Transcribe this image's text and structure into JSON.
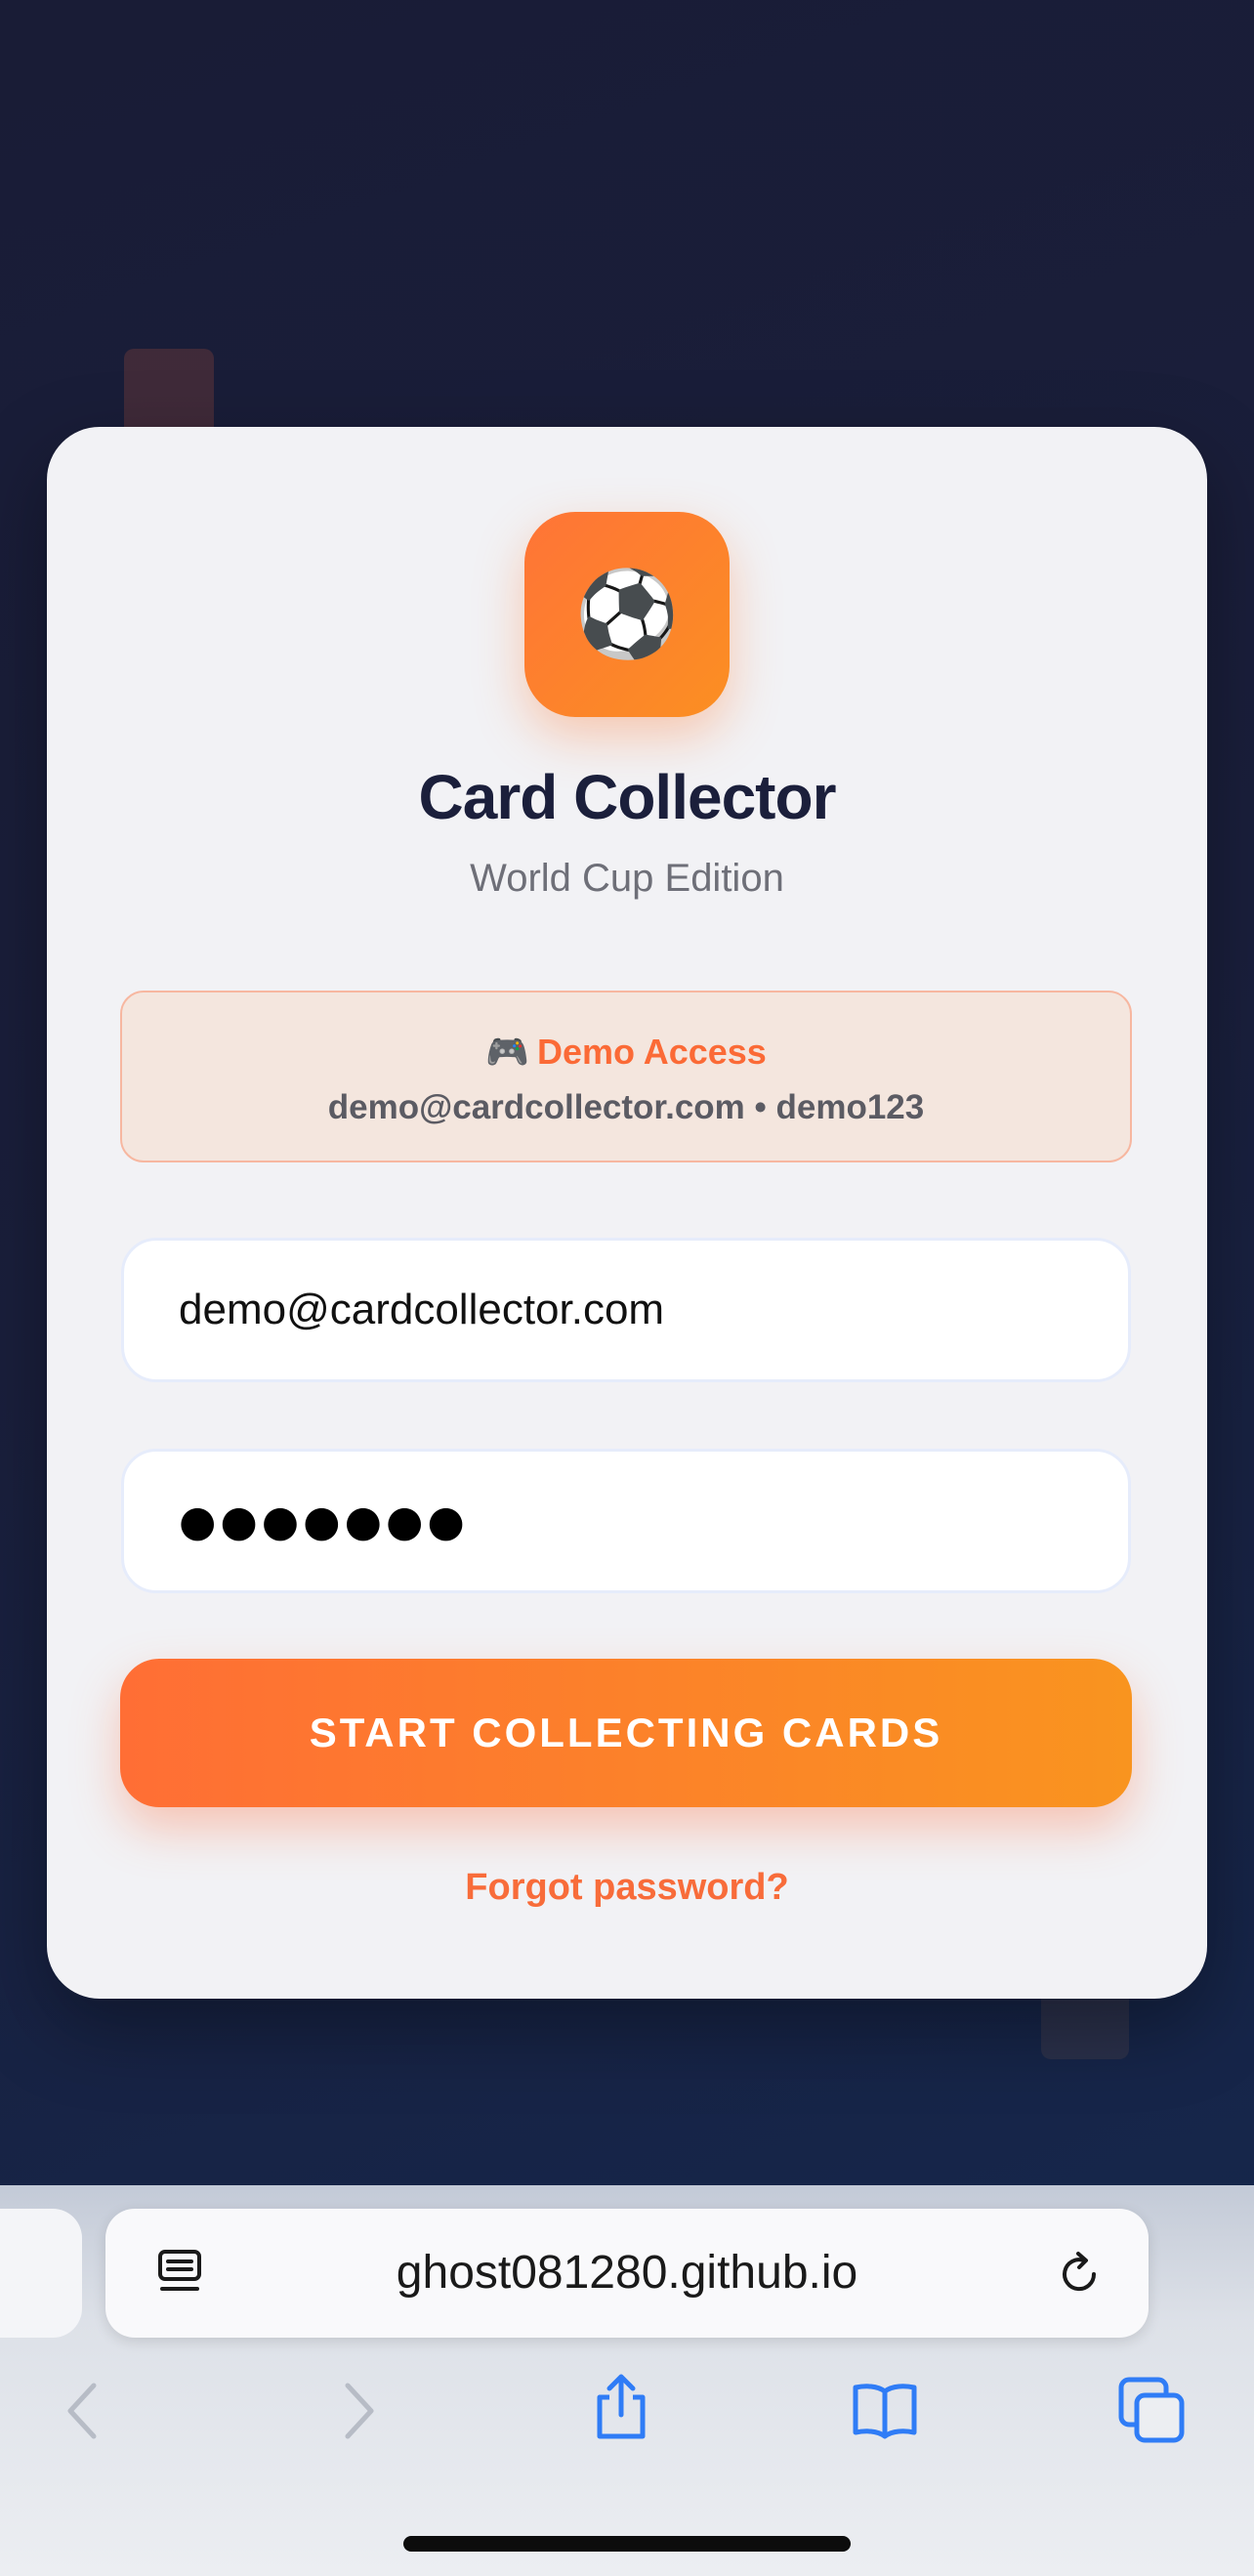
{
  "app": {
    "icon": "soccer-ball-icon",
    "icon_glyph": "⚽",
    "title": "Card Collector",
    "subtitle": "World Cup Edition"
  },
  "demo": {
    "icon": "game-controller-icon",
    "icon_glyph": "🎮",
    "label": "Demo Access",
    "credentials": "demo@cardcollector.com • demo123"
  },
  "form": {
    "email_value": "demo@cardcollector.com",
    "password_masked": "●●●●●●●",
    "submit_label": "START COLLECTING CARDS",
    "forgot_label": "Forgot password?"
  },
  "browser": {
    "url": "ghost081280.github.io",
    "icons": [
      "reader-icon",
      "reload-icon",
      "back-icon",
      "forward-icon",
      "share-icon",
      "bookmarks-icon",
      "tabs-icon"
    ]
  },
  "colors": {
    "accent": "#ff7437",
    "accent_end": "#f9941f",
    "title": "#1b1f3b",
    "browser_blue": "#2f7cf6"
  }
}
